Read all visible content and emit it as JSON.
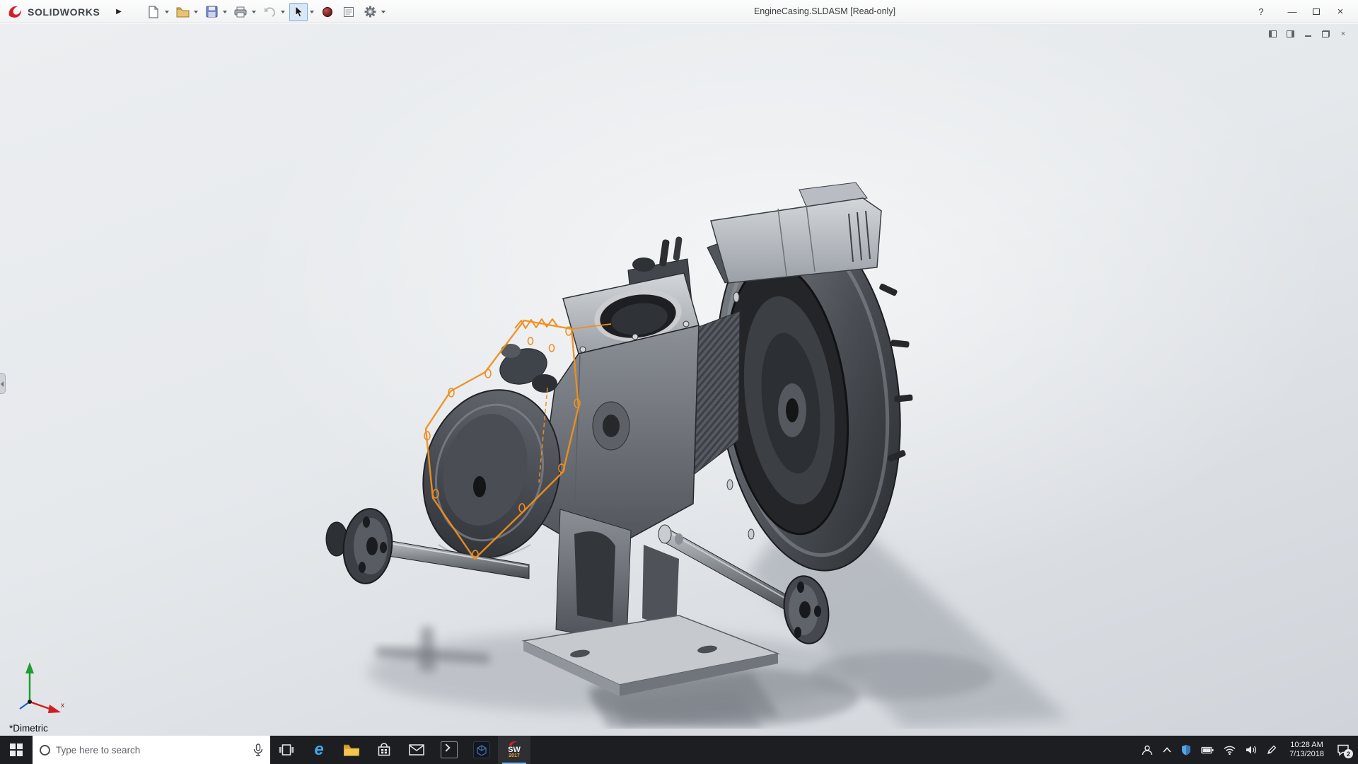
{
  "titlebar": {
    "brand": "SOLIDWORKS",
    "menu_expand_glyph": "▶",
    "document_title": "EngineCasing.SLDASM [Read-only]",
    "help_glyph": "?",
    "minimize_glyph": "—",
    "close_glyph": "×",
    "toolbar_icons": [
      "new-document",
      "open-document",
      "save",
      "print",
      "undo",
      "select-cursor",
      "appearance-sphere",
      "document-sheet",
      "settings-gear"
    ]
  },
  "document_window": {
    "controls": [
      "task-pane-left",
      "task-pane-right",
      "minimize",
      "restore",
      "close"
    ],
    "minimize_glyph": "—",
    "close_glyph": "×"
  },
  "viewport": {
    "view_orientation": "*Dimetric",
    "triad_x_label": "x"
  },
  "taskbar": {
    "search_placeholder": "Type here to search",
    "edge_glyph": "e",
    "solidworks_label": "SW",
    "solidworks_year": "2017",
    "app_icons": [
      "start",
      "search",
      "task-view",
      "edge",
      "file-explorer",
      "store",
      "mail",
      "command-prompt",
      "composer-app",
      "solidworks-2017"
    ],
    "tray_icons": [
      "people",
      "chevron-up",
      "defender-shield",
      "battery",
      "wifi",
      "volume",
      "pen"
    ],
    "clock": {
      "time": "10:28 AM",
      "date": "7/13/2018"
    },
    "notification_badge": "2"
  },
  "colors": {
    "sketch_orange": "#ef8f1f",
    "taskbar_bg": "#1c1e21",
    "titlebar_bg": "#f4f5f6",
    "active_tool_border": "#7fadd6"
  }
}
